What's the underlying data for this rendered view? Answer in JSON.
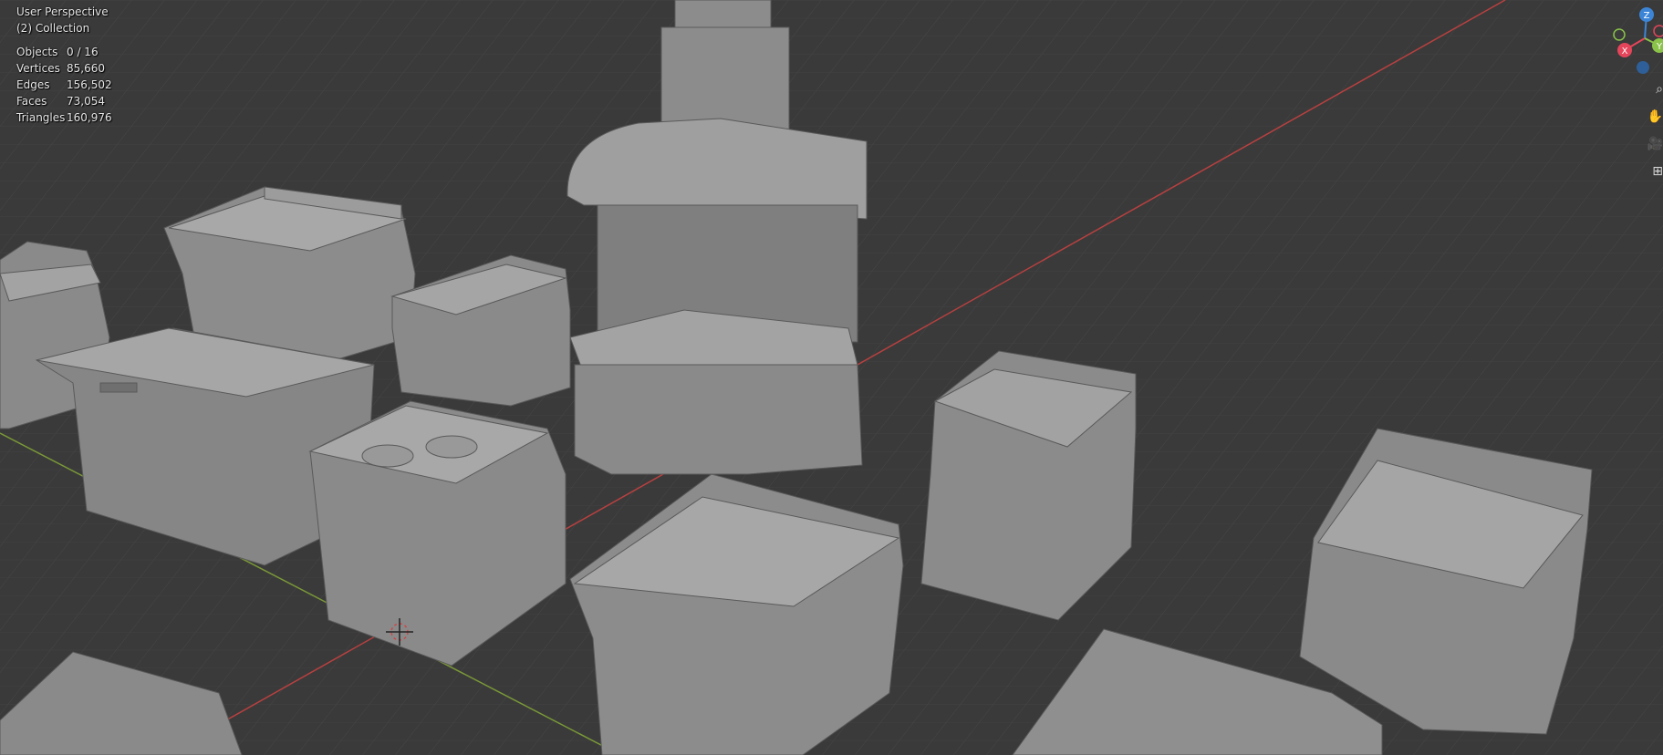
{
  "viewport": {
    "view_name": "User Perspective",
    "collection": "(2) Collection"
  },
  "stats": [
    {
      "label": "Objects",
      "value": "0 / 16"
    },
    {
      "label": "Vertices",
      "value": "85,660"
    },
    {
      "label": "Edges",
      "value": "156,502"
    },
    {
      "label": "Faces",
      "value": "73,054"
    },
    {
      "label": "Triangles",
      "value": "160,976"
    }
  ],
  "gizmo": {
    "z_label": "Z",
    "x_label": "X",
    "y_label": "Y",
    "colors": {
      "x": "#e5455a",
      "y": "#8bc34a",
      "z": "#3c85d6"
    }
  },
  "nav_icons": [
    "zoom-icon",
    "pan-hand-icon",
    "camera-icon",
    "grid-icon"
  ],
  "colors": {
    "background": "#3a3a3a",
    "grid": "#474747",
    "x_axis": "#c44545",
    "y_axis": "#7e9b3a",
    "mesh": "#8d8d8d"
  }
}
